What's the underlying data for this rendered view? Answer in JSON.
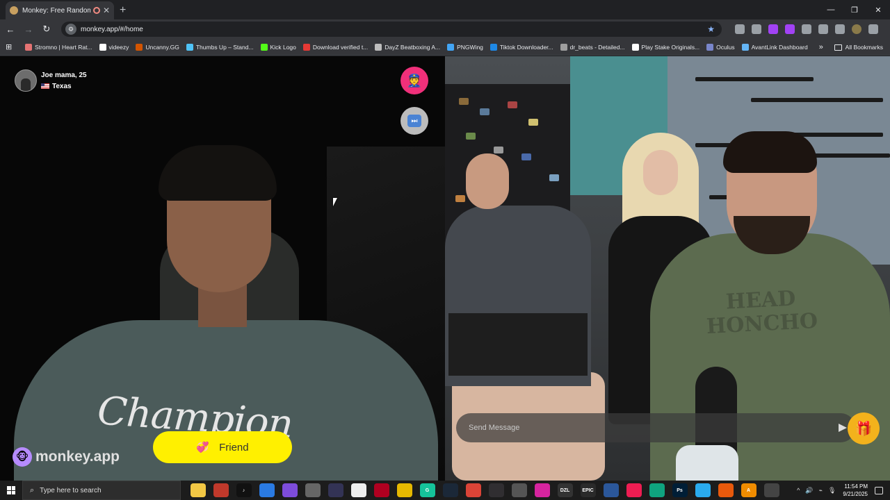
{
  "browser": {
    "tab_title": "Monkey: Free Random Vide",
    "tab_close": "✕",
    "new_tab": "+",
    "url": "monkey.app/#/home",
    "window_controls": [
      "—",
      "❐",
      "✕"
    ]
  },
  "bookmarks": [
    {
      "label": "Stromno | Heart Rat...",
      "color": "#e57373"
    },
    {
      "label": "videezy",
      "color": "#ffffff"
    },
    {
      "label": "Uncanny.GG",
      "color": "#d35400"
    },
    {
      "label": "Thumbs Up – Stand...",
      "color": "#4fc3f7"
    },
    {
      "label": "Kick Logo",
      "color": "#53fc18"
    },
    {
      "label": "Download verified t...",
      "color": "#e53935"
    },
    {
      "label": "DayZ Beatboxing A...",
      "color": "#bdbdbd"
    },
    {
      "label": "PNGWing",
      "color": "#42a5f5"
    },
    {
      "label": "Tiktok Downloader...",
      "color": "#1e88e5"
    },
    {
      "label": "dr_beats - Detailed...",
      "color": "#9e9e9e"
    },
    {
      "label": "Play Stake Originals...",
      "color": "#ffffff"
    },
    {
      "label": "Oculus",
      "color": "#7986cb"
    },
    {
      "label": "AvantLink Dashboard",
      "color": "#64b5f6"
    }
  ],
  "bookmarks_more": "»",
  "all_bookmarks": "All Bookmarks",
  "profile": {
    "name": "Joe mama, 25",
    "location": "Texas"
  },
  "brand": "monkey.app",
  "friend_label": "Friend",
  "chat": {
    "placeholder": "Send Message"
  },
  "shirts": {
    "left": "Champion",
    "right": "HEAD\nHONCHO"
  },
  "taskbar": {
    "search_placeholder": "Type here to search",
    "apps": [
      {
        "name": "file-explorer",
        "color": "#f2c744",
        "glyph": ""
      },
      {
        "name": "app-red",
        "color": "#c0392b",
        "glyph": ""
      },
      {
        "name": "tiktok",
        "color": "#111111",
        "glyph": "♪"
      },
      {
        "name": "app-blue",
        "color": "#2a7ae2",
        "glyph": ""
      },
      {
        "name": "app-purple",
        "color": "#7d4cdb",
        "glyph": ""
      },
      {
        "name": "app-gray",
        "color": "#666666",
        "glyph": ""
      },
      {
        "name": "app-dark",
        "color": "#333355",
        "glyph": ""
      },
      {
        "name": "notepad",
        "color": "#eeeeee",
        "glyph": ""
      },
      {
        "name": "app-crimson",
        "color": "#b00020",
        "glyph": ""
      },
      {
        "name": "app-yellow",
        "color": "#e6b800",
        "glyph": ""
      },
      {
        "name": "grammarly",
        "color": "#15c39a",
        "glyph": "G"
      },
      {
        "name": "steam",
        "color": "#1b2838",
        "glyph": ""
      },
      {
        "name": "chrome",
        "color": "#db4437",
        "glyph": ""
      },
      {
        "name": "obs",
        "color": "#302e31",
        "glyph": ""
      },
      {
        "name": "app-circle",
        "color": "#555555",
        "glyph": ""
      },
      {
        "name": "instagram",
        "color": "#d6249f",
        "glyph": ""
      },
      {
        "name": "dzl",
        "color": "#333333",
        "glyph": "DZL"
      },
      {
        "name": "epic",
        "color": "#2a2a2a",
        "glyph": "EPIC"
      },
      {
        "name": "app-window",
        "color": "#2b579a",
        "glyph": ""
      },
      {
        "name": "tiktok-live",
        "color": "#ee1d52",
        "glyph": ""
      },
      {
        "name": "edge",
        "color": "#0fa37f",
        "glyph": ""
      },
      {
        "name": "photoshop",
        "color": "#001e36",
        "glyph": "Ps"
      },
      {
        "name": "telegram",
        "color": "#2aabee",
        "glyph": ""
      },
      {
        "name": "app-orange",
        "color": "#e8590c",
        "glyph": ""
      },
      {
        "name": "app-a",
        "color": "#f08c00",
        "glyph": "A"
      },
      {
        "name": "app-pill",
        "color": "#444444",
        "glyph": ""
      }
    ],
    "time": "11:54 PM",
    "date": "9/21/2025"
  }
}
